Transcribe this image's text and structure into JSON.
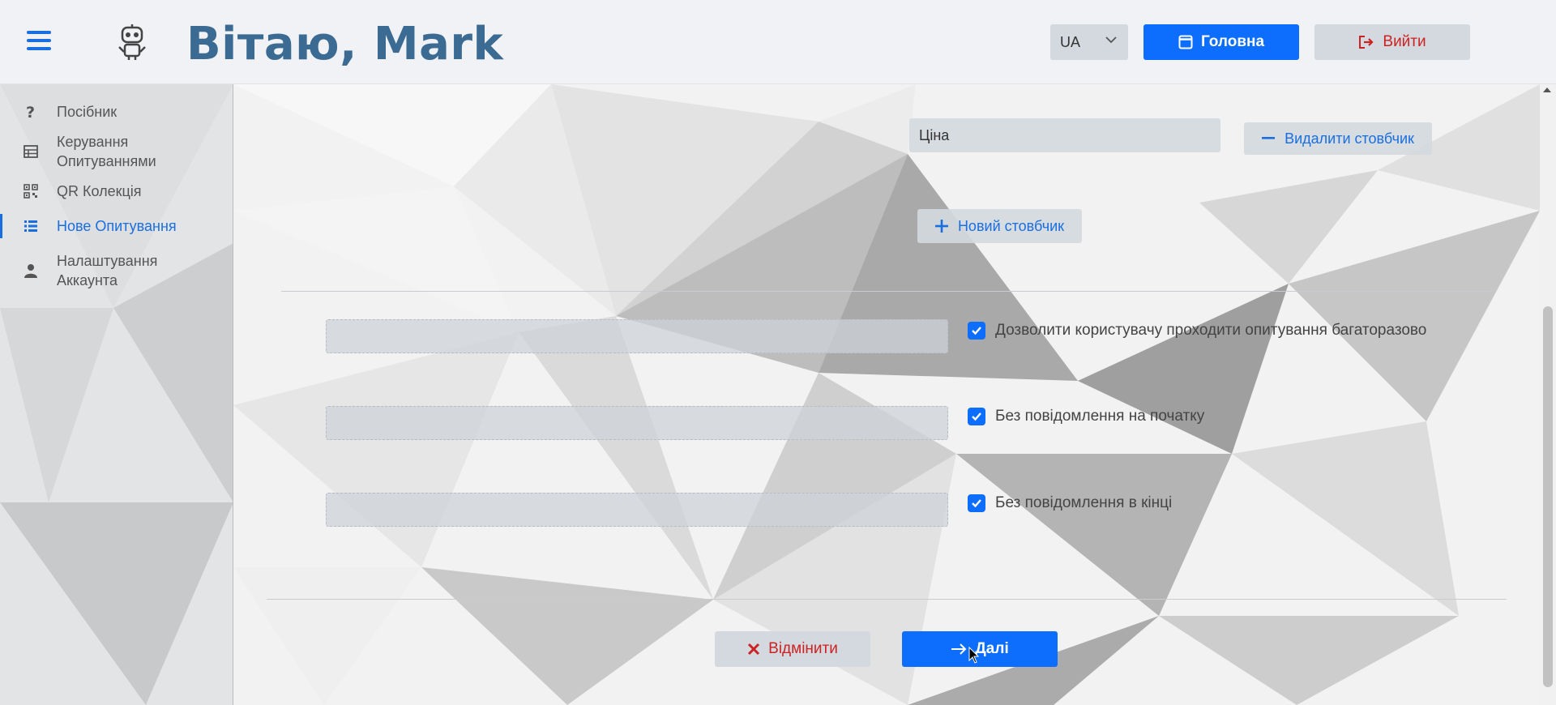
{
  "header": {
    "greeting": "Вітаю, Mark",
    "language": "UA",
    "home_label": "Головна",
    "exit_label": "Вийти"
  },
  "sidebar": {
    "items": [
      {
        "label": "Посібник",
        "icon": "question-icon"
      },
      {
        "label": "Керування Опитуваннями",
        "icon": "table-icon"
      },
      {
        "label": "QR Колекція",
        "icon": "qr-icon"
      },
      {
        "label": "Нове Опитування",
        "icon": "list-icon",
        "active": true
      },
      {
        "label": "Налаштування Аккаунта",
        "icon": "user-icon"
      }
    ]
  },
  "columns": {
    "column_value": "Ціна",
    "delete_label": "Видалити стовбчик",
    "new_label": "Новий стовбчик"
  },
  "options": [
    {
      "label": "Дозволити користувачу проходити опитування багаторазово",
      "checked": true
    },
    {
      "label": "Без повідомлення на початку",
      "checked": true
    },
    {
      "label": "Без повідомлення в кінці",
      "checked": true
    }
  ],
  "footer": {
    "cancel_label": "Відмінити",
    "next_label": "Далі"
  },
  "colors": {
    "accent": "#0d6efd",
    "title": "#3b6a92",
    "danger": "#cc2222"
  }
}
